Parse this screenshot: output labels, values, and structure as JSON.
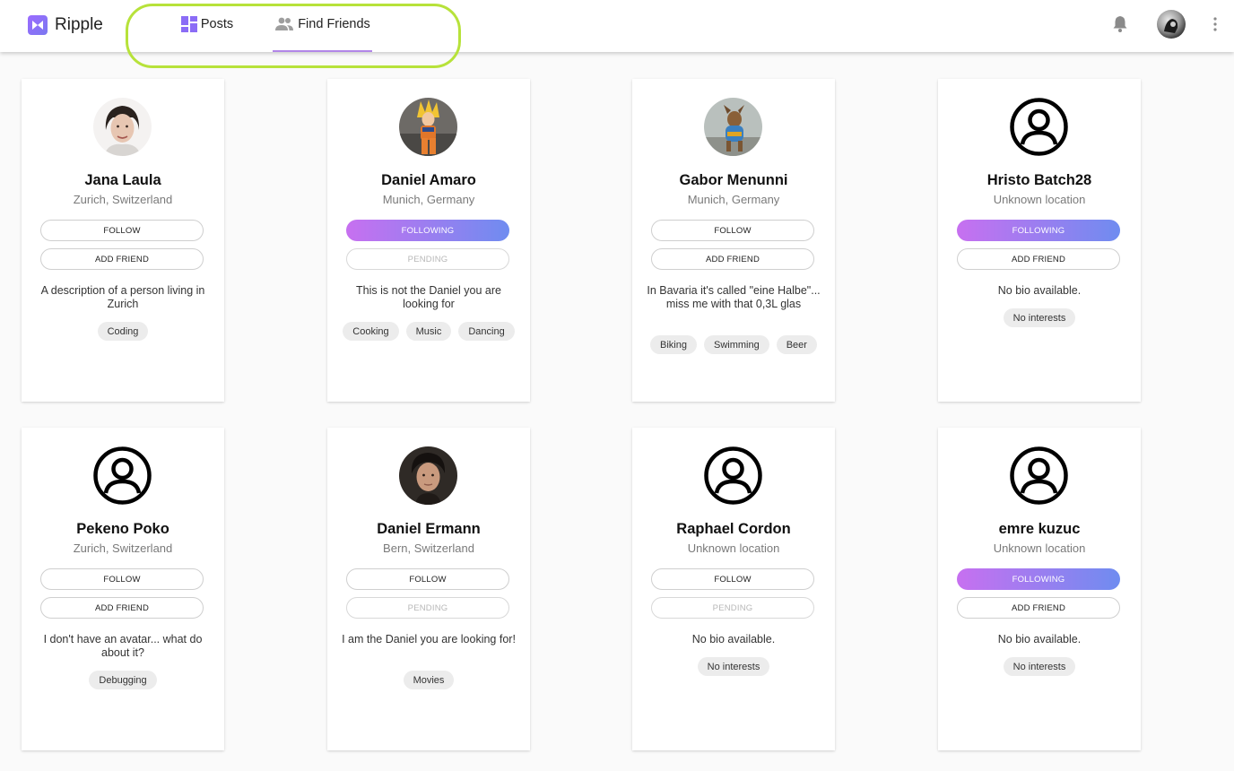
{
  "app": {
    "name": "Ripple",
    "brand_color": "#8b6cf6",
    "accent_gradient": [
      "#c770f0",
      "#6f8cf0"
    ],
    "highlight_color": "#b7e23a"
  },
  "nav": {
    "tabs": [
      {
        "label": "Posts",
        "icon": "dashboard-icon",
        "active": false
      },
      {
        "label": "Find Friends",
        "icon": "people-icon",
        "active": true
      }
    ]
  },
  "header_icons": [
    "bell-icon",
    "user-avatar",
    "more-vert-icon"
  ],
  "users": [
    {
      "name": "Jana Laula",
      "location": "Zurich, Switzerland",
      "avatar": "photo",
      "primary": "FOLLOW",
      "secondary": "ADD FRIEND",
      "bio": "A description of a person living in Zurich",
      "interests": [
        "Coding"
      ]
    },
    {
      "name": "Daniel Amaro",
      "location": "Munich, Germany",
      "avatar": "photo",
      "primary": "FOLLOWING",
      "secondary": "PENDING",
      "bio": "This is not the Daniel you are looking for",
      "interests": [
        "Cooking",
        "Music",
        "Dancing"
      ]
    },
    {
      "name": "Gabor Menunni",
      "location": "Munich, Germany",
      "avatar": "photo",
      "primary": "FOLLOW",
      "secondary": "ADD FRIEND",
      "bio": "In Bavaria it's called \"eine Halbe\"... miss me with that 0,3L glas",
      "interests": [
        "Biking",
        "Swimming",
        "Beer"
      ]
    },
    {
      "name": "Hristo Batch28",
      "location": "Unknown location",
      "avatar": "default",
      "primary": "FOLLOWING",
      "secondary": "ADD FRIEND",
      "bio": "No bio available.",
      "interests": [
        "No interests"
      ]
    },
    {
      "name": "Pekeno Poko",
      "location": "Zurich, Switzerland",
      "avatar": "default",
      "primary": "FOLLOW",
      "secondary": "ADD FRIEND",
      "bio": "I don't have an avatar... what do about it?",
      "interests": [
        "Debugging"
      ]
    },
    {
      "name": "Daniel Ermann",
      "location": "Bern, Switzerland",
      "avatar": "photo",
      "primary": "FOLLOW",
      "secondary": "PENDING",
      "bio": "I am the Daniel you are looking for!",
      "interests": [
        "Movies"
      ]
    },
    {
      "name": "Raphael Cordon",
      "location": "Unknown location",
      "avatar": "default",
      "primary": "FOLLOW",
      "secondary": "PENDING",
      "bio": "No bio available.",
      "interests": [
        "No interests"
      ]
    },
    {
      "name": "emre kuzuc",
      "location": "Unknown location",
      "avatar": "default",
      "primary": "FOLLOWING",
      "secondary": "ADD FRIEND",
      "bio": "No bio available.",
      "interests": [
        "No interests"
      ]
    }
  ]
}
